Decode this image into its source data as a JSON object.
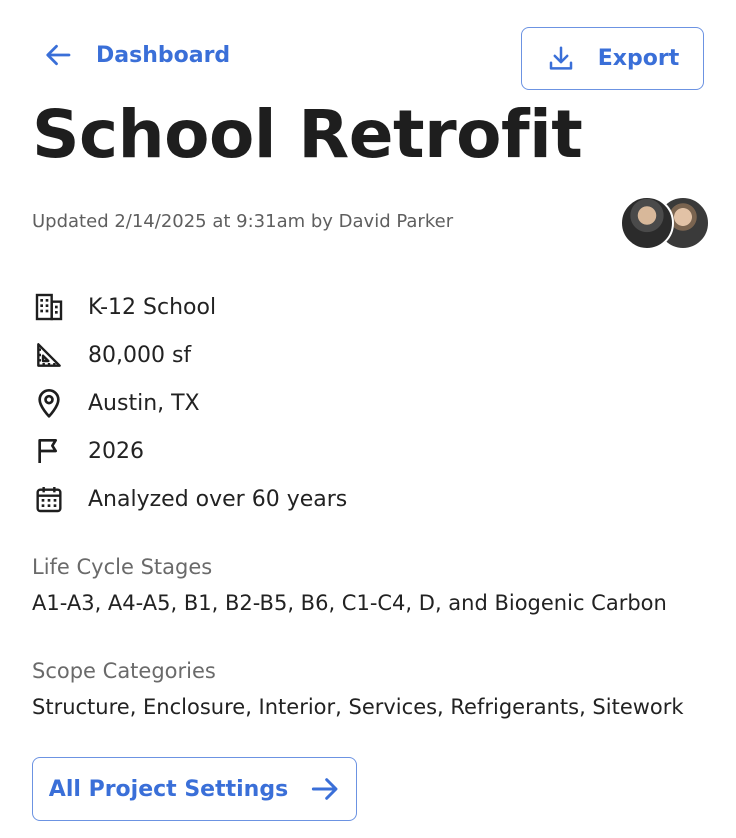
{
  "header": {
    "back_label": "Dashboard",
    "export_label": "Export"
  },
  "project": {
    "title": "School Retrofit",
    "updated": "Updated 2/14/2025 at 9:31am by David Parker"
  },
  "details": [
    {
      "icon": "building-icon",
      "text": "K-12 School"
    },
    {
      "icon": "ruler-triangle-icon",
      "text": "80,000 sf"
    },
    {
      "icon": "location-pin-icon",
      "text": "Austin, TX"
    },
    {
      "icon": "flag-icon",
      "text": "2026"
    },
    {
      "icon": "calendar-icon",
      "text": "Analyzed over 60 years"
    }
  ],
  "life_cycle": {
    "label": "Life Cycle Stages",
    "value": "A1-A3, A4-A5, B1, B2-B5, B6, C1-C4, D, and Biogenic Carbon"
  },
  "scope": {
    "label": "Scope Categories",
    "value": "Structure, Enclosure, Interior, Services, Refrigerants, Sitework"
  },
  "footer": {
    "settings_label": "All Project Settings"
  },
  "colors": {
    "accent": "#3a6fd8",
    "border": "#6c93e2"
  }
}
